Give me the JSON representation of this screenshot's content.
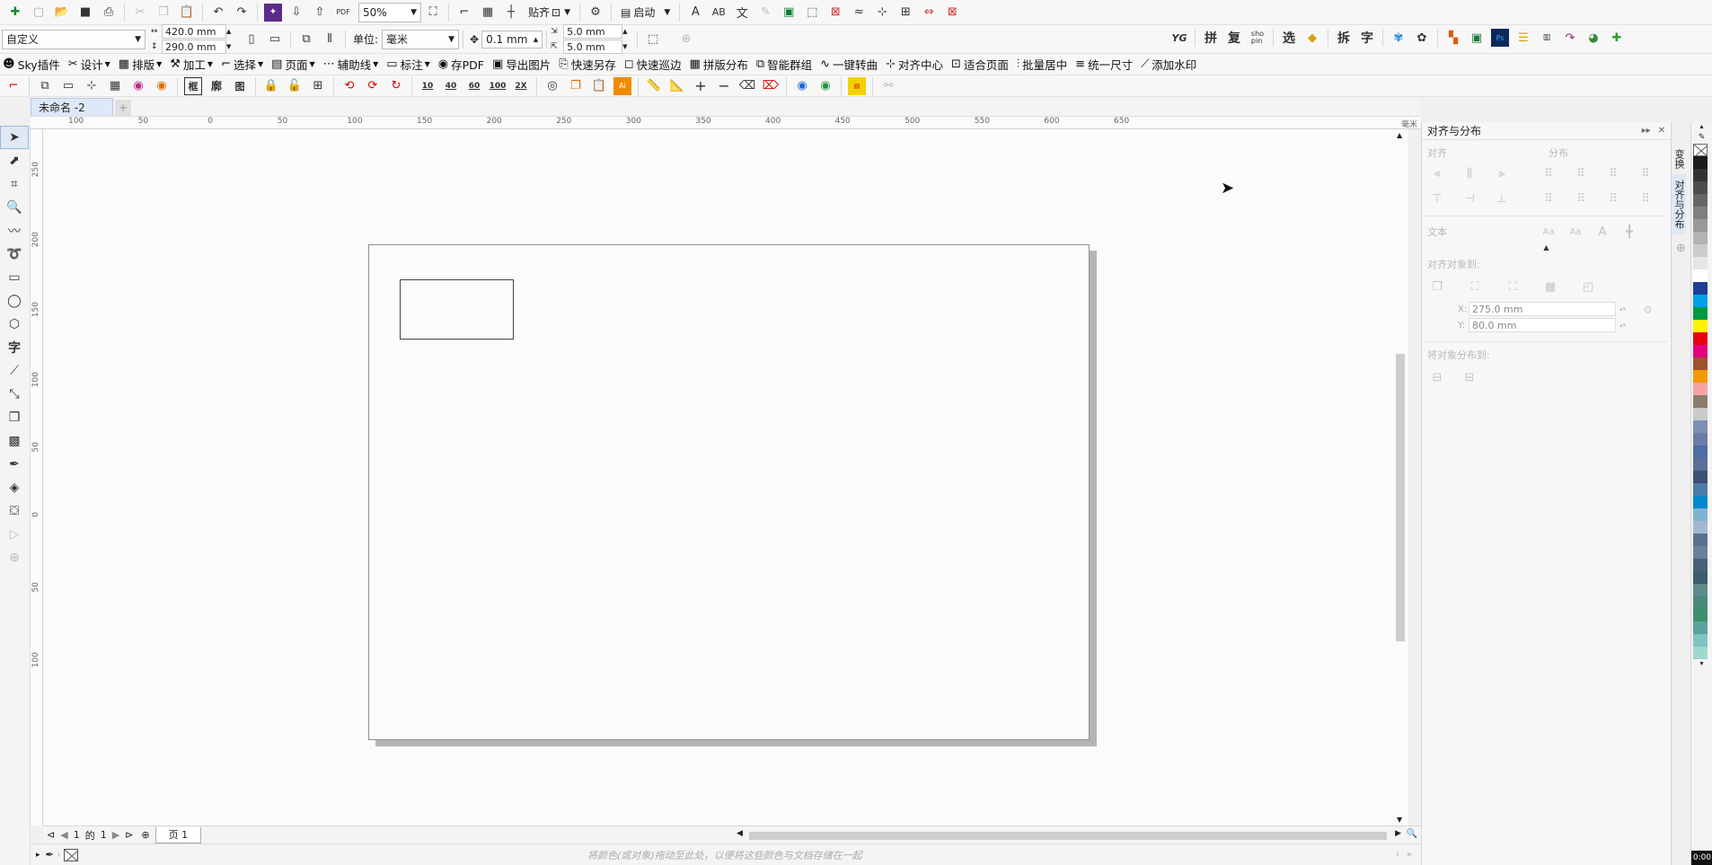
{
  "toolbar1": {
    "zoom": "50%",
    "snap_label": "贴齐",
    "launch_label": "启动",
    "pdf_label": "PDF"
  },
  "property_bar": {
    "preset": "自定义",
    "width": "420.0 mm",
    "height": "290.0 mm",
    "units_label": "单位:",
    "units": "毫米",
    "nudge": "0.1 mm",
    "dup_x": "5.0 mm",
    "dup_y": "5.0 mm",
    "right_buttons": [
      "拼",
      "复",
      "选",
      "拆",
      "字"
    ],
    "shopin": "sho\npin",
    "yg": "YG"
  },
  "plugin_bar": {
    "items": [
      {
        "label": "Sky插件",
        "dropdown": false
      },
      {
        "label": "设计",
        "dropdown": true
      },
      {
        "label": "排版",
        "dropdown": true
      },
      {
        "label": "加工",
        "dropdown": true
      },
      {
        "label": "选择",
        "dropdown": true
      },
      {
        "label": "页面",
        "dropdown": true
      },
      {
        "label": "辅助线",
        "dropdown": true
      },
      {
        "label": "标注",
        "dropdown": true
      },
      {
        "label": "存PDF",
        "dropdown": false
      },
      {
        "label": "导出图片",
        "dropdown": false
      },
      {
        "label": "快速另存",
        "dropdown": false
      },
      {
        "label": "快速巡边",
        "dropdown": false
      },
      {
        "label": "拼版分布",
        "dropdown": false
      },
      {
        "label": "智能群组",
        "dropdown": false
      },
      {
        "label": "一键转曲",
        "dropdown": false
      },
      {
        "label": "对齐中心",
        "dropdown": false
      },
      {
        "label": "适合页面",
        "dropdown": false
      },
      {
        "label": "批量居中",
        "dropdown": false
      },
      {
        "label": "统一尺寸",
        "dropdown": false
      },
      {
        "label": "添加水印",
        "dropdown": false
      }
    ]
  },
  "toolbar4": {
    "chars": [
      "框",
      "廓",
      "图"
    ],
    "nums": [
      "10",
      "40",
      "60",
      "100",
      "2X"
    ]
  },
  "document": {
    "tab_title": "未命名 -2",
    "page_tab": "页 1",
    "page_indicator_current": "1",
    "page_indicator_of": "的",
    "page_indicator_total": "1",
    "ruler_unit": "毫米"
  },
  "ruler": {
    "h_labels": [
      "100",
      "50",
      "0",
      "50",
      "100",
      "150",
      "200",
      "250",
      "300",
      "350",
      "400",
      "450",
      "500",
      "550",
      "600",
      "650"
    ],
    "v_labels": [
      "250",
      "200",
      "150",
      "100",
      "50",
      "0",
      "50",
      "100"
    ]
  },
  "panel": {
    "title": "对齐与分布",
    "align_label": "对齐",
    "distribute_label": "分布",
    "text_label": "文本",
    "align_to_label": "对齐对象到:",
    "x_label": "X:",
    "x_value": "275.0 mm",
    "y_label": "Y:",
    "y_value": "80.0 mm",
    "distribute_to_label": "将对象分布到:",
    "side_tab_transform": "变换",
    "side_tab_align": "对齐与分布"
  },
  "statusbar": {
    "hint": "将颜色(或对象)拖动至此处，以便将这些颜色与文档存储在一起",
    "clock": "0:00"
  },
  "palette": {
    "colors": [
      "#1a1a1a",
      "#333333",
      "#4d4d4d",
      "#666666",
      "#808080",
      "#999999",
      "#b3b3b3",
      "#cccccc",
      "#e6e6e6",
      "#ffffff",
      "#1c3f94",
      "#00a0e9",
      "#009944",
      "#fff100",
      "#e60012",
      "#e4007f",
      "#a0522d",
      "#f39800",
      "#f5a3a3",
      "#8c7c6c",
      "#c9caca",
      "#7e8fb6",
      "#6a7ca5",
      "#4c6da5",
      "#5a6e96",
      "#3d4f73",
      "#4a7aa8",
      "#0088cc",
      "#7fb3d5",
      "#a3b8d0",
      "#5c7090",
      "#6b7f9a",
      "#486078",
      "#3b5e6b",
      "#5f8a8b",
      "#4a8a7a",
      "#3e8e6e",
      "#5ba3a0",
      "#7fc4c0",
      "#a0d8d0"
    ]
  }
}
